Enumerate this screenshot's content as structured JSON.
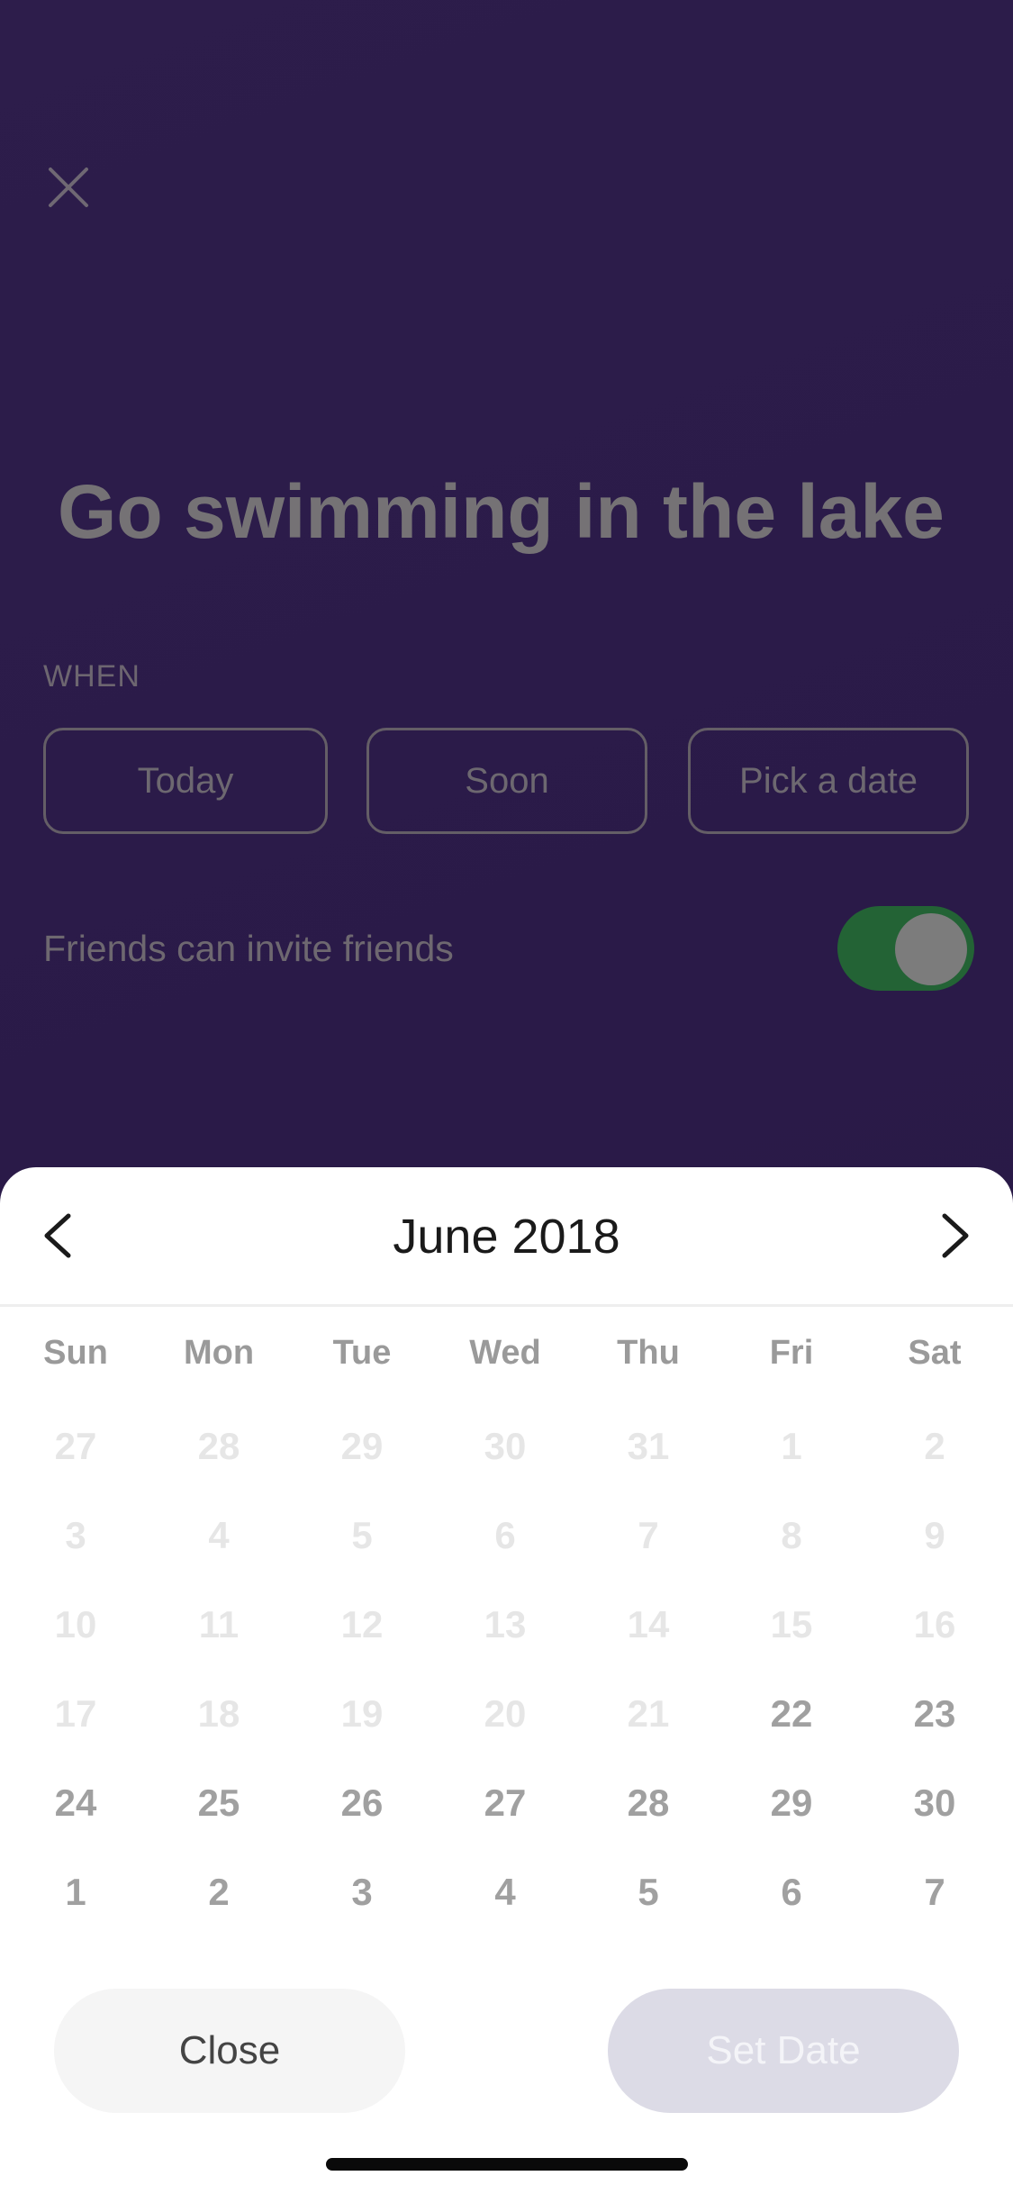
{
  "form": {
    "title": "Go swimming in the lake",
    "when_label": "WHEN",
    "when_options": [
      "Today",
      "Soon",
      "Pick a date"
    ],
    "invite_label": "Friends can invite friends",
    "invite_enabled": true
  },
  "calendar": {
    "month_title": "June 2018",
    "weekdays": [
      "Sun",
      "Mon",
      "Tue",
      "Wed",
      "Thu",
      "Fri",
      "Sat"
    ],
    "weeks": [
      [
        "27",
        "28",
        "29",
        "30",
        "31",
        "1",
        "2"
      ],
      [
        "3",
        "4",
        "5",
        "6",
        "7",
        "8",
        "9"
      ],
      [
        "10",
        "11",
        "12",
        "13",
        "14",
        "15",
        "16"
      ],
      [
        "17",
        "18",
        "19",
        "20",
        "21",
        "22",
        "23"
      ],
      [
        "24",
        "25",
        "26",
        "27",
        "28",
        "29",
        "30"
      ],
      [
        "1",
        "2",
        "3",
        "4",
        "5",
        "6",
        "7"
      ]
    ],
    "selectable": [
      [
        false,
        false,
        false,
        false,
        false,
        false,
        false
      ],
      [
        false,
        false,
        false,
        false,
        false,
        false,
        false
      ],
      [
        false,
        false,
        false,
        false,
        false,
        false,
        false
      ],
      [
        false,
        false,
        false,
        false,
        false,
        true,
        true
      ],
      [
        true,
        true,
        true,
        true,
        true,
        true,
        true
      ],
      [
        true,
        true,
        true,
        true,
        true,
        true,
        true
      ]
    ]
  },
  "footer": {
    "close_label": "Close",
    "set_label": "Set Date"
  },
  "icons": {
    "close": "close-icon",
    "prev": "chevron-left-icon",
    "next": "chevron-right-icon"
  },
  "colors": {
    "background": "#2a1a48",
    "toggle_on": "#236335",
    "sheet": "#ffffff",
    "set_button": "#dcdbe6"
  }
}
